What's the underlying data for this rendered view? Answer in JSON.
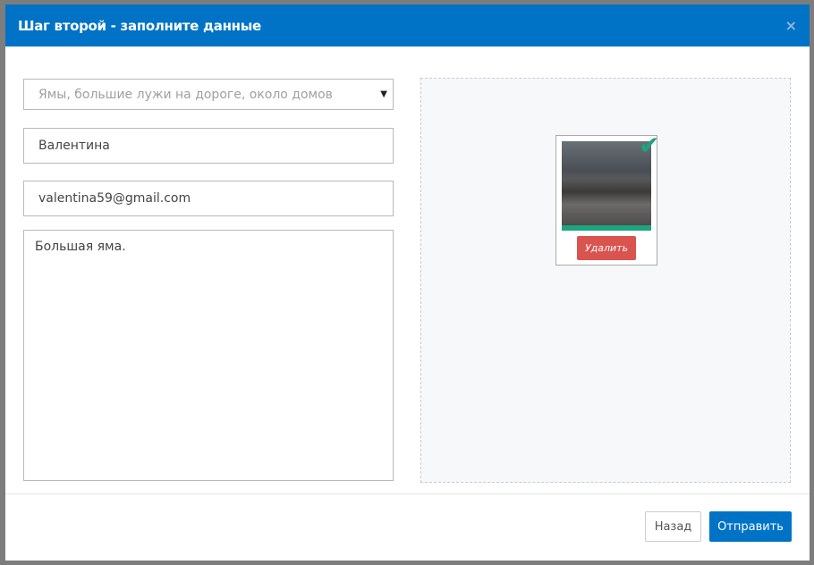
{
  "modal": {
    "title": "Шаг второй - заполните данные",
    "close_icon": "×"
  },
  "form": {
    "category_placeholder": "Ямы, большие лужи на дороге, около домов",
    "name": "Валентина",
    "email": "valentina59@gmail.com",
    "description": "Большая яма."
  },
  "upload": {
    "delete_label": "Удалить",
    "check_icon": "✔"
  },
  "footer": {
    "back_label": "Назад",
    "submit_label": "Отправить"
  },
  "colors": {
    "primary": "#0073c6",
    "success": "#1aa57f",
    "danger": "#d9534f"
  }
}
